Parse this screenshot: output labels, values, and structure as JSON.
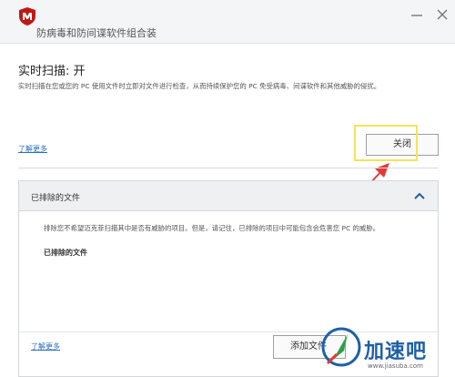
{
  "window": {
    "title": "防病毒和防间谍软件组合装"
  },
  "scan": {
    "title": "实时扫描: 开",
    "description": "实时扫描在您或您的 PC 使用文件时立即对文件进行检查，从而持续保护您的 PC 免受病毒、间谍软件和其他威胁的侵扰。",
    "learn_more": "了解更多",
    "off_button": "关闭"
  },
  "excluded": {
    "panel_title": "已排除的文件",
    "description": "排除您不希望迈克菲扫描其中是否有威胁的项目。但是，请记住，已排除的项目中可能包含会危害您 PC 的威胁。",
    "list_label": "已排除的文件",
    "learn_more": "了解更多",
    "add_button": "添加文件"
  },
  "watermark": {
    "brand": "加速吧",
    "url": "www.jiasuba.com"
  },
  "colors": {
    "brand_red": "#c01818",
    "link_blue": "#2a6ebb",
    "highlight_yellow": "#f5e35a",
    "arrow_red": "#e53935"
  }
}
